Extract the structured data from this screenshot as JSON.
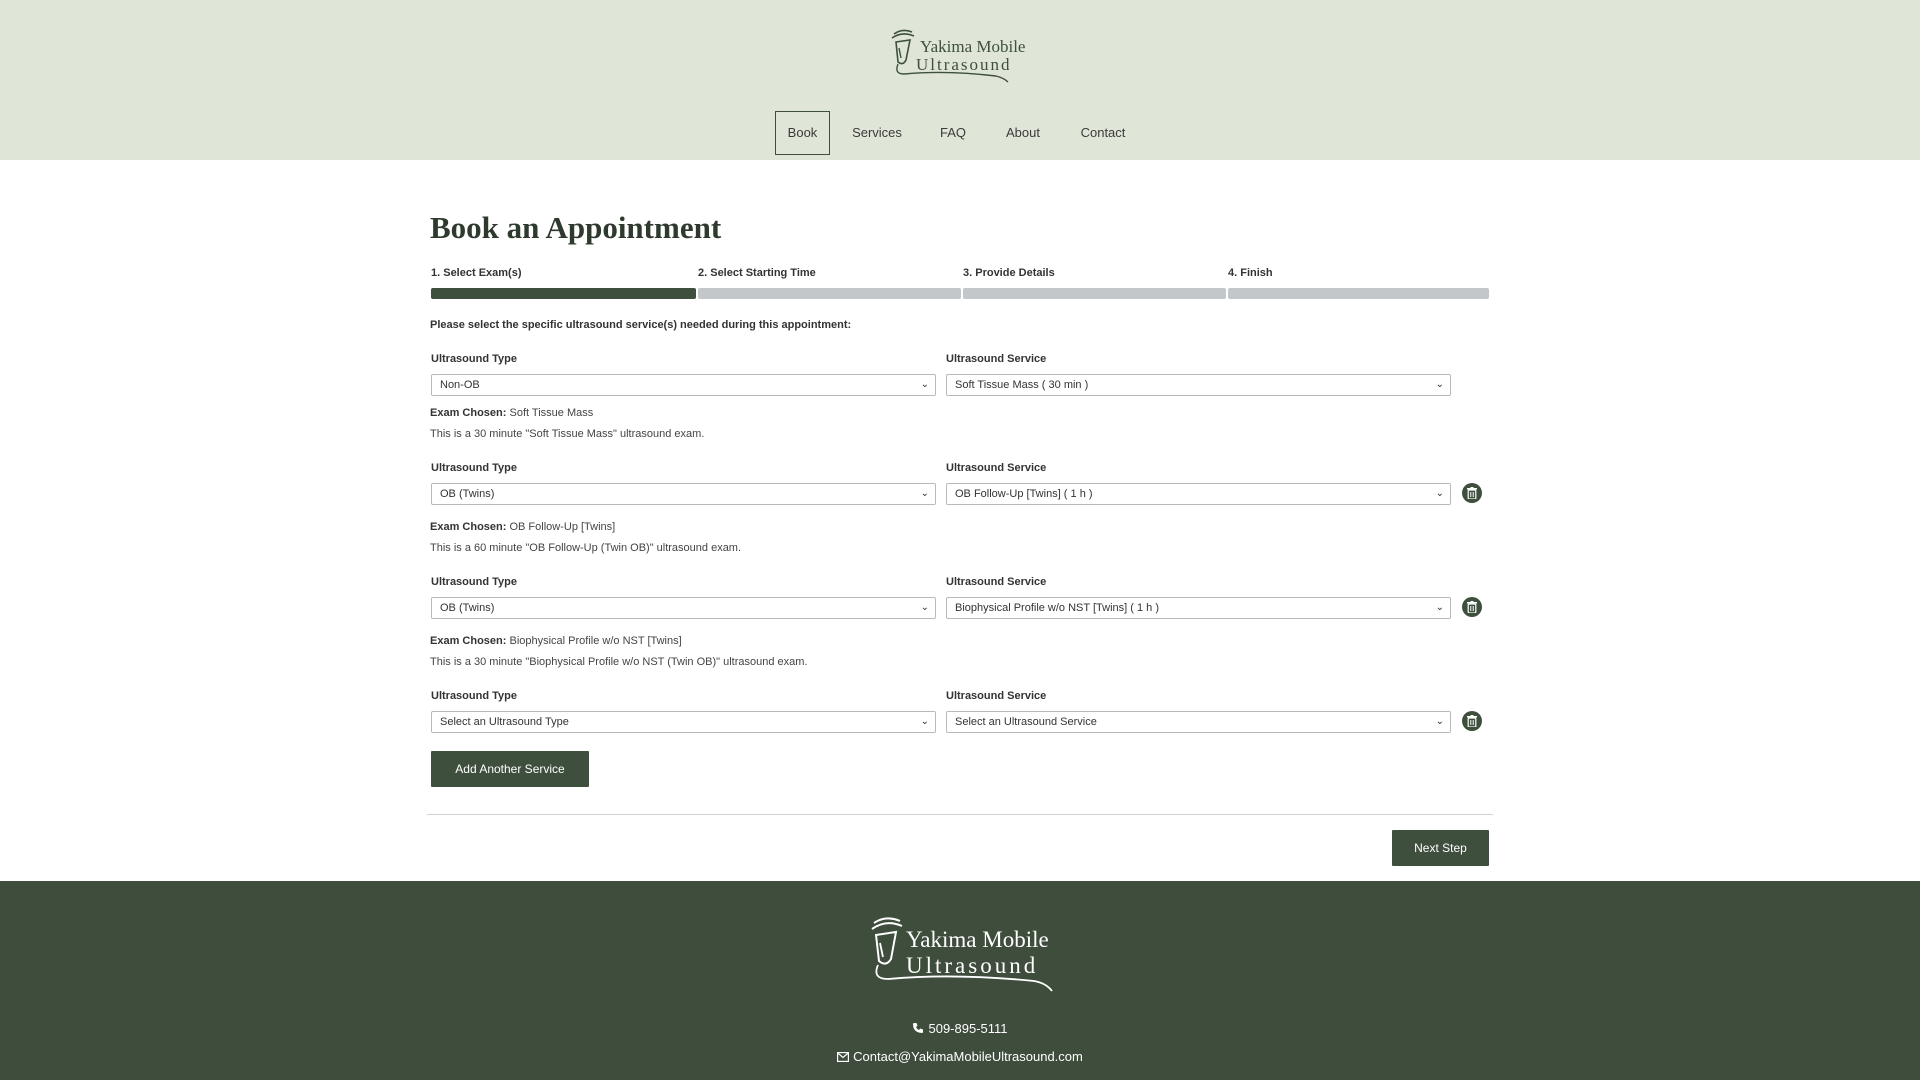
{
  "brand": {
    "name_line1": "Yakima Mobile",
    "name_line2": "Ultrasound",
    "color_primary": "#3e4d3c",
    "color_header_bg": "#dfe6d8"
  },
  "nav": {
    "items": [
      {
        "label": "Book",
        "active": true
      },
      {
        "label": "Services",
        "active": false
      },
      {
        "label": "FAQ",
        "active": false
      },
      {
        "label": "About",
        "active": false
      },
      {
        "label": "Contact",
        "active": false
      }
    ]
  },
  "page": {
    "title": "Book an Appointment",
    "instruction": "Please select the specific ultrasound service(s) needed during this appointment:"
  },
  "steps": [
    {
      "label": "1. Select Exam(s)",
      "complete": true
    },
    {
      "label": "2. Select Starting Time",
      "complete": false
    },
    {
      "label": "3. Provide Details",
      "complete": false
    },
    {
      "label": "4. Finish",
      "complete": false
    }
  ],
  "labels": {
    "type": "Ultrasound Type",
    "service": "Ultrasound Service",
    "exam_chosen": "Exam Chosen:"
  },
  "services": [
    {
      "type": "Non-OB",
      "service": "Soft Tissue Mass ( 30 min )",
      "exam": "Soft Tissue Mass",
      "description": "This is a 30 minute \"Soft Tissue Mass\" ultrasound exam.",
      "icon": "trash-icon"
    },
    {
      "type": "OB (Twins)",
      "service": "OB Follow-Up [Twins] ( 1 h )",
      "exam": "OB Follow-Up [Twins]",
      "description": "This is a 60 minute \"OB Follow-Up (Twin OB)\" ultrasound exam.",
      "icon": "trash-icon"
    },
    {
      "type": "OB (Twins)",
      "service": "Biophysical Profile w/o NST [Twins] ( 1 h )",
      "exam": "Biophysical Profile w/o NST [Twins]",
      "description": "This is a 30 minute \"Biophysical Profile w/o NST (Twin OB)\" ultrasound exam.",
      "icon": "trash-icon"
    },
    {
      "type": "Select an Ultrasound Type",
      "service": "Select an Ultrasound Service",
      "icon": "trash-icon"
    }
  ],
  "buttons": {
    "add_service": "Add Another Service",
    "next_step": "Next Step"
  },
  "footer": {
    "phone": "509-895-5111",
    "email": "Contact@YakimaMobileUltrasound.com",
    "phone_icon": "phone-icon",
    "email_icon": "envelope-icon"
  }
}
